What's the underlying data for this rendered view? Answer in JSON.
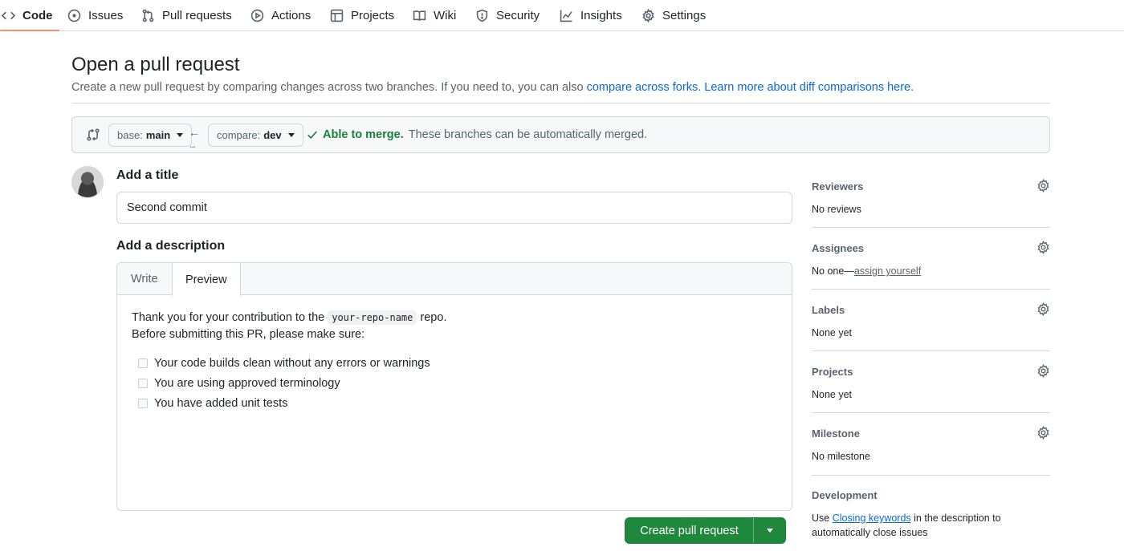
{
  "nav": {
    "items": [
      {
        "label": "Code",
        "icon": "code-icon"
      },
      {
        "label": "Issues",
        "icon": "issue-icon"
      },
      {
        "label": "Pull requests",
        "icon": "pull-request-icon"
      },
      {
        "label": "Actions",
        "icon": "play-icon"
      },
      {
        "label": "Projects",
        "icon": "table-icon"
      },
      {
        "label": "Wiki",
        "icon": "book-icon"
      },
      {
        "label": "Security",
        "icon": "shield-icon"
      },
      {
        "label": "Insights",
        "icon": "graph-icon"
      },
      {
        "label": "Settings",
        "icon": "gear-icon"
      }
    ],
    "active": "Code"
  },
  "header": {
    "title": "Open a pull request",
    "subtitle_text": "Create a new pull request by comparing changes across two branches. If you need to, you can also ",
    "link_forks": "compare across forks.",
    "link_learn": "Learn more about diff comparisons here."
  },
  "compare": {
    "base_prefix": "base:",
    "base_branch": "main",
    "compare_prefix": "compare:",
    "compare_branch": "dev",
    "arrow": "←",
    "dots": "...",
    "merge_ok": "Able to merge.",
    "merge_text": "These branches can be automatically merged."
  },
  "form": {
    "title_label": "Add a title",
    "title_value": "Second commit",
    "description_label": "Add a description",
    "tabs": [
      "Write",
      "Preview"
    ],
    "active_tab": "Preview",
    "preview": {
      "line1_before": "Thank you for your contribution to the ",
      "line1_code": "your-repo-name",
      "line1_after": " repo.",
      "line2": "Before submitting this PR, please make sure:",
      "tasks": [
        "Your code builds clean without any errors or warnings",
        "You are using approved terminology",
        "You have added unit tests"
      ]
    },
    "submit_label": "Create pull request"
  },
  "sidebar": {
    "reviewers": {
      "head": "Reviewers",
      "value": "No reviews"
    },
    "assignees": {
      "head": "Assignees",
      "value_prefix": "No one—",
      "value_link": "assign yourself"
    },
    "labels": {
      "head": "Labels",
      "value": "None yet"
    },
    "projects": {
      "head": "Projects",
      "value": "None yet"
    },
    "milestone": {
      "head": "Milestone",
      "value": "No milestone"
    },
    "development": {
      "head": "Development",
      "text_before": "Use ",
      "link": "Closing keywords",
      "text_after": " in the description to automatically close issues"
    }
  },
  "colors": {
    "accent": "#0969da",
    "success": "#1a7f37",
    "button": "#1f883d",
    "active_tab_underline": "#fd8c73"
  }
}
